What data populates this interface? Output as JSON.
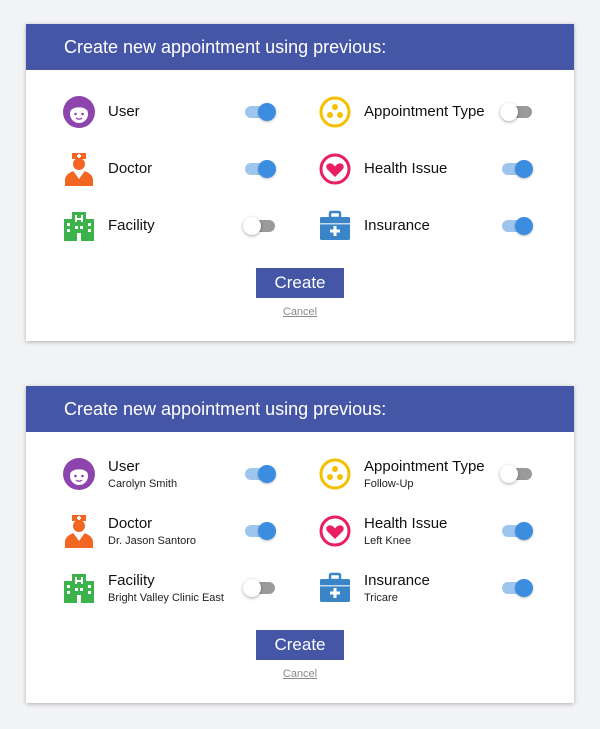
{
  "colors": {
    "header": "#4656a7",
    "button": "#4656a7",
    "toggle_on": "#3b8de0",
    "toggle_on_track": "#9ec5ee",
    "toggle_off_track": "#9a9a9a",
    "user_icon": "#8e44ad",
    "doctor_icon": "#f26522",
    "facility_icon": "#3cb34a",
    "appointment_type_icon": "#f5c000",
    "health_issue_icon": "#e91e63",
    "insurance_icon": "#3a85c8"
  },
  "card1": {
    "title": "Create new appointment using previous:",
    "items": {
      "user": {
        "label": "User",
        "icon": "user-icon",
        "toggle": true
      },
      "doctor": {
        "label": "Doctor",
        "icon": "doctor-icon",
        "toggle": true
      },
      "facility": {
        "label": "Facility",
        "icon": "hospital-building-icon",
        "toggle": false
      },
      "appointment_type": {
        "label": "Appointment Type",
        "icon": "appointment-type-icon",
        "toggle": false
      },
      "health_issue": {
        "label": "Health Issue",
        "icon": "heart-icon",
        "toggle": true
      },
      "insurance": {
        "label": "Insurance",
        "icon": "medical-briefcase-icon",
        "toggle": true
      }
    },
    "create_label": "Create",
    "cancel_label": "Cancel"
  },
  "card2": {
    "title": "Create new appointment using previous:",
    "items": {
      "user": {
        "label": "User",
        "value": "Carolyn Smith",
        "icon": "user-icon",
        "toggle": true
      },
      "doctor": {
        "label": "Doctor",
        "value": "Dr. Jason Santoro",
        "icon": "doctor-icon",
        "toggle": true
      },
      "facility": {
        "label": "Facility",
        "value": "Bright Valley Clinic East",
        "icon": "hospital-building-icon",
        "toggle": false
      },
      "appointment_type": {
        "label": "Appointment Type",
        "value": "Follow-Up",
        "icon": "appointment-type-icon",
        "toggle": false
      },
      "health_issue": {
        "label": "Health Issue",
        "value": "Left Knee",
        "icon": "heart-icon",
        "toggle": true
      },
      "insurance": {
        "label": "Insurance",
        "value": "Tricare",
        "icon": "medical-briefcase-icon",
        "toggle": true
      }
    },
    "create_label": "Create",
    "cancel_label": "Cancel"
  }
}
